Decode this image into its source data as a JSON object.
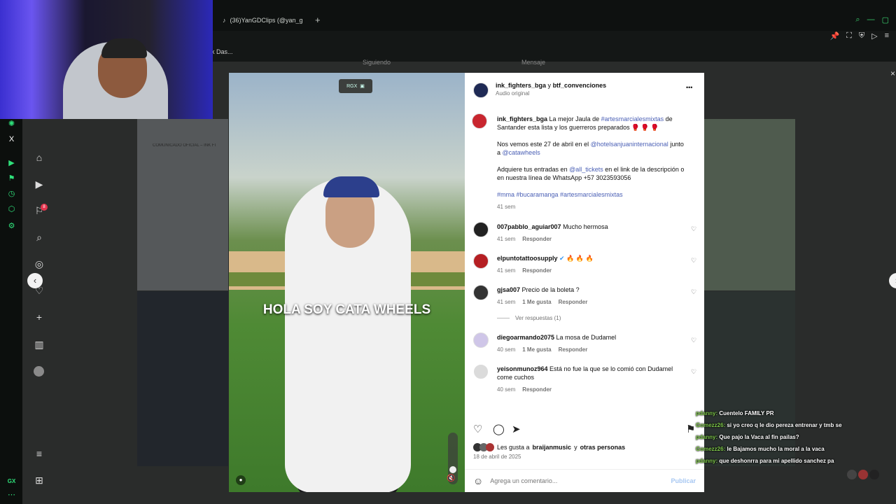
{
  "browser": {
    "tab_title": "(36)YanGDClips (@yan_g",
    "new_tab": "+",
    "address_fragment": "k Das...",
    "gx_logo": "GX"
  },
  "behind_page": {
    "tab_following": "Siguiendo",
    "tab_messages": "Mensaje",
    "notification_count": "8",
    "doc_header": "COMUNICADO OFICIAL – INK FI"
  },
  "video": {
    "caption": "HOLA SOY CATA WHEELS",
    "watermark": "RGX"
  },
  "post": {
    "header_user": "ink_fighters_bga",
    "header_joiner": "y",
    "header_user2": "btf_convenciones",
    "header_audio": "Audio original",
    "more": "•••",
    "caption_user": "ink_fighters_bga",
    "caption_text1a": "La mejor Jaula de",
    "caption_tag1": "#artesmarcialesmixtas",
    "caption_text1b": "de Santander esta lista y los guerreros preparados 🥊 🥊 🥊",
    "caption_text2a": "Nos vemos este 27 de abril en el",
    "caption_mention1": "@hotelsanjuaninternacional",
    "caption_text2b": "junto a",
    "caption_mention2": "@catawheels",
    "caption_text3a": "Adquiere tus entradas en",
    "caption_mention3": "@all_tickets",
    "caption_text3b": "en el link de la descripción o en nuestra línea de WhatsApp +57 3023593056",
    "caption_tags": "#mma #bucaramanga #artesmarcialesmixtas",
    "caption_time": "41 sem",
    "comments": [
      {
        "user": "007pabblo_aguiar007",
        "text": "Mucho hermosa",
        "time": "41 sem",
        "likes": "",
        "reply": "Responder"
      },
      {
        "user": "elpuntotattoosupply",
        "text": "🔥 🔥 🔥",
        "time": "41 sem",
        "likes": "",
        "reply": "Responder"
      },
      {
        "user": "gjsa007",
        "text": "Precio de la boleta ?",
        "time": "41 sem",
        "likes": "1 Me gusta",
        "reply": "Responder"
      },
      {
        "user": "diegoarmando2075",
        "text": "La mosa de Dudamel",
        "time": "40 sem",
        "likes": "1 Me gusta",
        "reply": "Responder"
      },
      {
        "user": "yeisonmunoz964",
        "text": "Está no fue la que se lo comió con Dudamel come cuchos",
        "time": "40 sem",
        "likes": "",
        "reply": "Responder"
      }
    ],
    "view_replies": "Ver respuestas (1)",
    "likes_prefix": "Les gusta a",
    "likes_user": "braijanmusic",
    "likes_suffix": "y",
    "likes_others": "otras personas",
    "date": "18 de abril de 2025",
    "comment_placeholder": "Agrega un comentario...",
    "publish": "Publicar"
  },
  "chat": [
    {
      "user": "pdanny:",
      "text": "Cuentelo FAMILY PR"
    },
    {
      "user": "Gomezz26:",
      "text": "si yo creo q le dio pereza entrenar y tmb se"
    },
    {
      "user": "pdanny:",
      "text": "Que pajo la Vaca al fin pailas?"
    },
    {
      "user": "Gomezz26:",
      "text": "le Bajamos mucho la moral a la vaca"
    },
    {
      "user": "pdanny:",
      "text": "que deshonrra para mi apellido sanchez pa"
    }
  ],
  "colors": {
    "gx_accent": "#2fe07a",
    "link": "#4a5fb5",
    "verified": "#3897f0"
  }
}
